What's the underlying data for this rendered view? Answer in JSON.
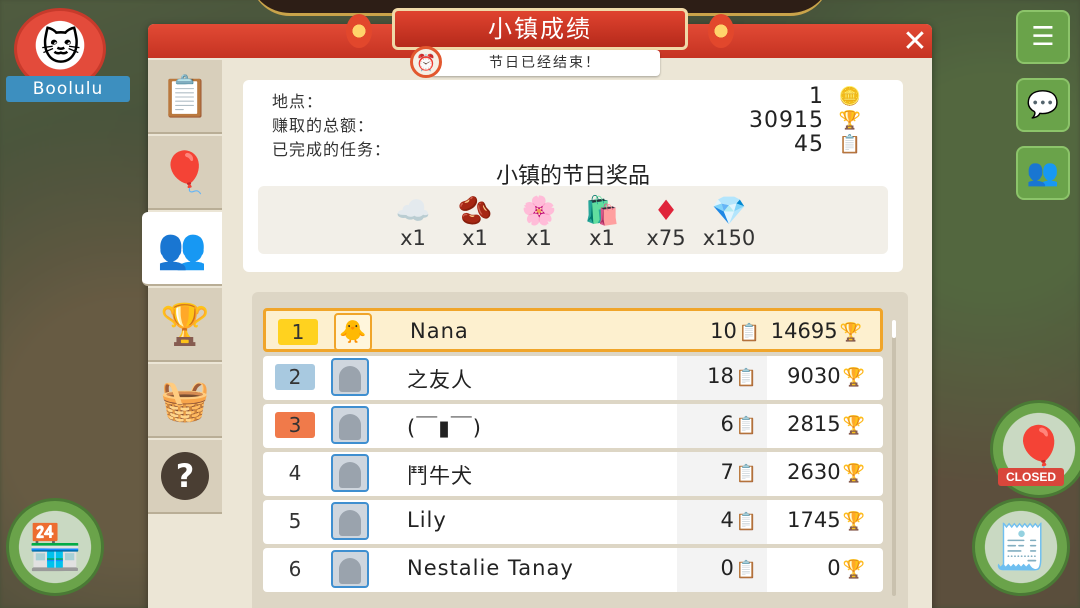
{
  "player": {
    "name": "Boolulu"
  },
  "header": {
    "title": "小镇成绩",
    "subtitle": "节日已经结束！",
    "close_label": "✕"
  },
  "stats": [
    {
      "label": "地点：",
      "value": "1",
      "icon": "coins-icon"
    },
    {
      "label": "赚取的总额：",
      "value": "30915",
      "icon": "trophy-icon"
    },
    {
      "label": "已完成的任务：",
      "value": "45",
      "icon": "task-list-icon"
    }
  ],
  "rewards": {
    "title": "小镇的节日奖品",
    "items": [
      {
        "icon": "cotton-icon",
        "qty": "x1"
      },
      {
        "icon": "cocoa-icon",
        "qty": "x1"
      },
      {
        "icon": "saffron-icon",
        "qty": "x1"
      },
      {
        "icon": "gift-bag-icon",
        "qty": "x1"
      },
      {
        "icon": "ruby-icon",
        "qty": "x75"
      },
      {
        "icon": "diamond-icon",
        "qty": "x150"
      }
    ]
  },
  "leaderboard": [
    {
      "rank": "1",
      "name": "Nana",
      "tasks": "10",
      "trophies": "14695",
      "highlight": true
    },
    {
      "rank": "2",
      "name": "之友人",
      "tasks": "18",
      "trophies": "9030"
    },
    {
      "rank": "3",
      "name": "(￣▮￣)",
      "tasks": "6",
      "trophies": "2815"
    },
    {
      "rank": "4",
      "name": "鬥牛犬",
      "tasks": "7",
      "trophies": "2630"
    },
    {
      "rank": "5",
      "name": "Lily",
      "tasks": "4",
      "trophies": "1745"
    },
    {
      "rank": "6",
      "name": "Nestalie Tanay",
      "tasks": "0",
      "trophies": "0"
    }
  ],
  "hud": {
    "closed_label": "CLOSED"
  },
  "colors": {
    "header_red": "#d13a27",
    "highlight_border": "#f0a52a",
    "gold_rank": "#ffd21f",
    "silver_rank": "#a8c9e0",
    "bronze_rank": "#f07a4a"
  }
}
